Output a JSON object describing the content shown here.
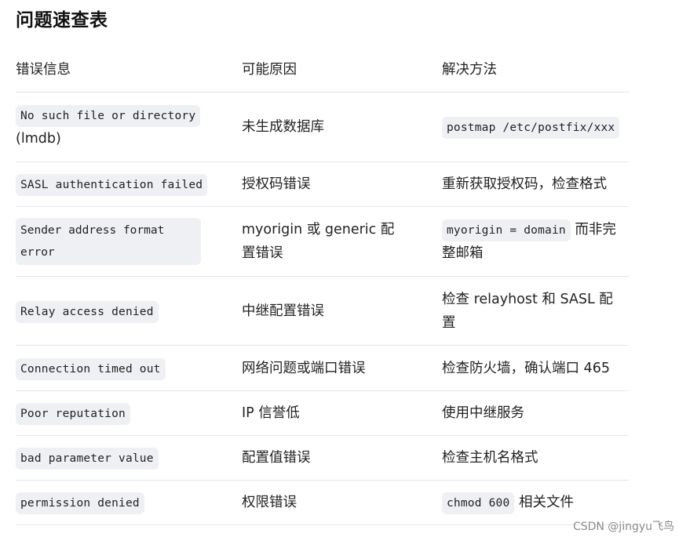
{
  "title": "问题速查表",
  "headers": {
    "error": "错误信息",
    "cause": "可能原因",
    "solution": "解决方法"
  },
  "rows": [
    {
      "error_code": "No such file or directory",
      "error_text": "(lmdb)",
      "cause": "未生成数据库",
      "solution_code": "postmap /etc/postfix/xxx",
      "solution_text": ""
    },
    {
      "error_code": "SASL authentication failed",
      "error_text": "",
      "cause": "授权码错误",
      "solution_code": "",
      "solution_text": "重新获取授权码，检查格式"
    },
    {
      "error_code_line1": "Sender address format",
      "error_code_line2": "error",
      "cause_line1": "myorigin 或 generic 配",
      "cause_line2": "置错误",
      "solution_code": "myorigin = domain",
      "solution_text_line1": " 而非完",
      "solution_text_line2": "整邮箱"
    },
    {
      "error_code": "Relay access denied",
      "cause": "中继配置错误",
      "solution_line1": "检查 relayhost 和 SASL 配",
      "solution_line2": "置"
    },
    {
      "error_code": "Connection timed out",
      "cause": "网络问题或端口错误",
      "solution_text": "检查防火墙，确认端口 465"
    },
    {
      "error_code": "Poor reputation",
      "cause": "IP 信誉低",
      "solution_text": "使用中继服务"
    },
    {
      "error_code": "bad parameter value",
      "cause": "配置值错误",
      "solution_text": "检查主机名格式"
    },
    {
      "error_code": "permission denied",
      "cause": "权限错误",
      "solution_code": "chmod 600",
      "solution_text": " 相关文件"
    }
  ],
  "watermark": "CSDN @jingyu飞鸟",
  "colors": {
    "code_background": "#eef0f3",
    "row_divider": "#e4e6eb",
    "text": "#222222"
  }
}
